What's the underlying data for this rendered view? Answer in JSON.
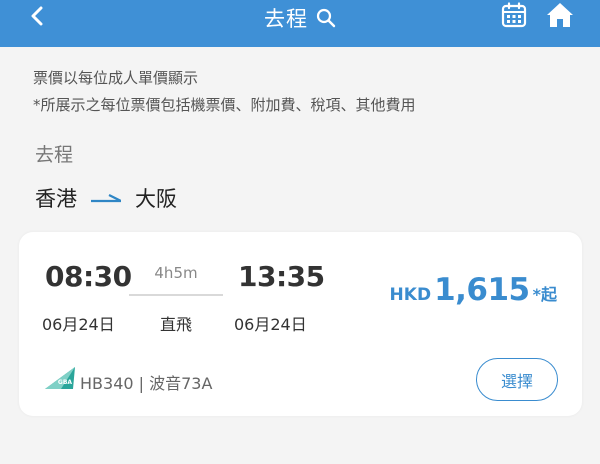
{
  "header": {
    "title": "去程",
    "bg_color": "#3f90d6",
    "back_icon": "chevron-left-icon",
    "search_icon": "search-icon",
    "calendar_icon": "calendar-icon",
    "home_icon": "home-icon"
  },
  "notes": {
    "line1": "票價以每位成人單價顯示",
    "line2": "*所展示之每位票價包括機票價、附加費、稅項、其他費用"
  },
  "section": {
    "label": "去程"
  },
  "route": {
    "origin": "香港",
    "destination": "大阪"
  },
  "flight": {
    "departure_time": "08:30",
    "departure_date": "06月24日",
    "duration": "4h5m",
    "stops": "直飛",
    "arrival_time": "13:35",
    "arrival_date": "06月24日",
    "price_currency": "HKD",
    "price_amount": "1,615",
    "price_suffix": "*起",
    "flight_info": "HB340 | 波音73A",
    "airline_logo": "GBA",
    "select_label": "選擇",
    "accent_color": "#3a8ccf"
  }
}
